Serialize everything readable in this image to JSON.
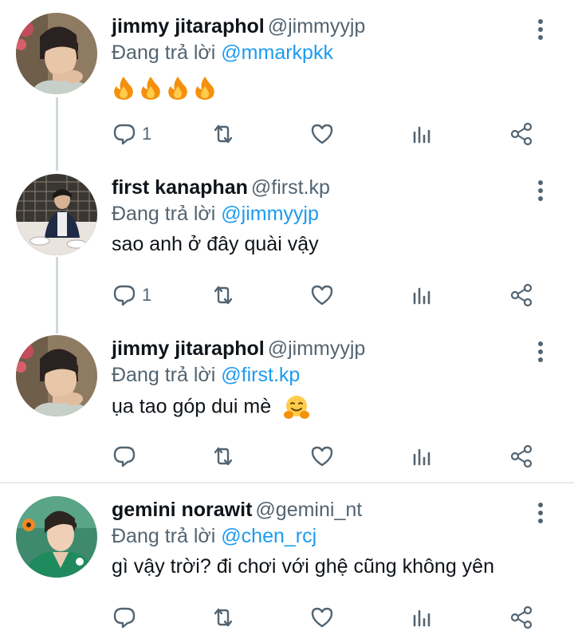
{
  "tweets": [
    {
      "name": "jimmy jitaraphol",
      "handle": "@jimmyyjp",
      "reply_prefix": "Đang trả lời",
      "reply_to": "@mmarkpkk",
      "text": "",
      "emoji": [
        "🔥",
        "🔥",
        "🔥",
        "🔥"
      ],
      "reply_count": "1",
      "avatar": "jimmy-avatar"
    },
    {
      "name": "first kanaphan",
      "handle": "@first.kp",
      "reply_prefix": "Đang trả lời",
      "reply_to": "@jimmyyjp",
      "text": "sao anh ở đây quài vậy",
      "reply_count": "1",
      "avatar": "first-avatar"
    },
    {
      "name": "jimmy jitaraphol",
      "handle": "@jimmyyjp",
      "reply_prefix": "Đang trả lời",
      "reply_to": "@first.kp",
      "text": "ụa tao góp dui mè",
      "emoji": [
        "🤗"
      ],
      "reply_count": "",
      "avatar": "jimmy-avatar"
    },
    {
      "name": "gemini norawit",
      "handle": "@gemini_nt",
      "reply_prefix": "Đang trả lời",
      "reply_to": "@chen_rcj",
      "text": "gì vậy trời? đi chơi với ghệ cũng không yên",
      "reply_count": "",
      "avatar": "gemini-avatar"
    }
  ],
  "icons": {
    "reply": "reply-icon",
    "retweet": "retweet-icon",
    "like": "heart-icon",
    "analytics": "analytics-icon",
    "share": "share-icon",
    "more": "more-vertical-icon"
  },
  "colors": {
    "link": "#1d9bf0",
    "secondary_text": "#536471",
    "thread_line": "#cfd9de",
    "icon": "#536471"
  }
}
